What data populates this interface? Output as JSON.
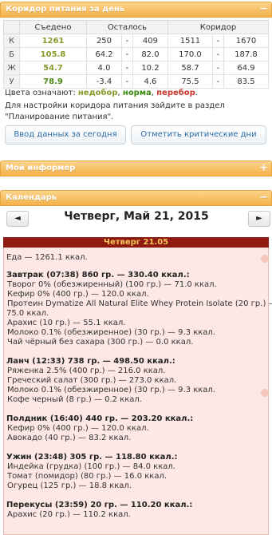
{
  "corridor": {
    "header": "Коридор питания за день",
    "toggle": "−",
    "columns": [
      "",
      "Съедено",
      "Осталось",
      "",
      "",
      "Коридор",
      "",
      ""
    ],
    "col_eaten": "Съедено",
    "col_left": "Осталось",
    "col_corr": "Коридор",
    "rows": [
      {
        "label": "К",
        "eaten": "1261",
        "left_min": "250",
        "left_max": "409",
        "corr_min": "1511",
        "corr_max": "1670"
      },
      {
        "label": "Б",
        "eaten": "105.8",
        "left_min": "64.2",
        "left_max": "82.0",
        "corr_min": "170.0",
        "corr_max": "187.8"
      },
      {
        "label": "Ж",
        "eaten": "54.7",
        "left_min": "4.0",
        "left_max": "10.2",
        "corr_min": "58.7",
        "corr_max": "64.9"
      },
      {
        "label": "У",
        "eaten": "78.9",
        "left_min": "-3.4",
        "left_max": "4.6",
        "corr_min": "75.5",
        "corr_max": "83.5"
      }
    ],
    "dash": "-",
    "legend_prefix": "Цвета означают:",
    "legend_under": "недобор",
    "legend_norm": "норма",
    "legend_over": "перебор",
    "info": "Для настройки коридора питания зайдите в раздел \"Планирование питания\".",
    "btn_today": "Ввод данных за сегодня",
    "btn_critical": "Отметить критические дни"
  },
  "informer": {
    "header": "Мой информер",
    "toggle": "+"
  },
  "calendar": {
    "header": "Календарь",
    "toggle": "−",
    "prev": "◄",
    "next": "►",
    "title": "Четверг, Май 21, 2015",
    "day_label": "Четверг 21.05",
    "lines": [
      {
        "text": "Еда — 1261.1 ккал.",
        "kind": "plain"
      },
      {
        "text": "Завтрак (07:38) 860 гр. — 330.40 ккал.:",
        "kind": "bold"
      },
      {
        "text": "Творог 0% (обезжиренный) (100 гр.) — 71.0 ккал.",
        "kind": "item"
      },
      {
        "text": "Кефир 0% (400 гр.) — 120.0 ккал.",
        "kind": "item"
      },
      {
        "text": "Протеин Dymatize All Natural Elite Whey Protein Isolate (20 гр.) —",
        "kind": "item"
      },
      {
        "text": "75.0 ккал.",
        "kind": "plain"
      },
      {
        "text": "Арахис (10 гр.) — 55.1 ккал.",
        "kind": "item"
      },
      {
        "text": "Молоко 0.1% (обезжиренное) (30 гр.) — 9.3 ккал.",
        "kind": "item"
      },
      {
        "text": "Чай чёрный без сахара (300 гр.) — 0.0 ккал.",
        "kind": "item"
      },
      {
        "text": "Ланч (12:33) 738 гр. — 498.50 ккал.:",
        "kind": "bold"
      },
      {
        "text": "Ряженка 2.5% (400 гр.) — 216.0 ккал.",
        "kind": "item"
      },
      {
        "text": "Греческий салат (300 гр.) — 273.0 ккал.",
        "kind": "item"
      },
      {
        "text": "Молоко 0.1% (обезжиренное) (30 гр.) — 9.3 ккал.",
        "kind": "item"
      },
      {
        "text": "Кофе черный (8 гр.) — 0.2 ккал.",
        "kind": "item"
      },
      {
        "text": "Полдник (16:40) 440 гр. — 203.20 ккал.:",
        "kind": "bold"
      },
      {
        "text": "Кефир 0% (400 гр.) — 120.0 ккал.",
        "kind": "item"
      },
      {
        "text": "Авокадо (40 гр.) — 83.2 ккал.",
        "kind": "item"
      },
      {
        "text": "Ужин (23:48) 305 гр. — 118.80 ккал.:",
        "kind": "bold"
      },
      {
        "text": "Индейка (грудка) (100 гр.) — 84.0 ккал.",
        "kind": "item"
      },
      {
        "text": "Томат (помидор) (80 гр.) — 16.0 ккал.",
        "kind": "item"
      },
      {
        "text": "Огурец (125 гр.) — 18.8 ккал.",
        "kind": "item"
      },
      {
        "text": "Перекусы (23:59) 20 гр. — 110.20 ккал.:",
        "kind": "bold"
      },
      {
        "text": "Арахис (20 гр.) — 110.2 ккал.",
        "kind": "item"
      }
    ]
  },
  "colors": {
    "accent": "#f5b24a",
    "day_header": "#8e1a10",
    "day_bg": "#fde8e6"
  }
}
